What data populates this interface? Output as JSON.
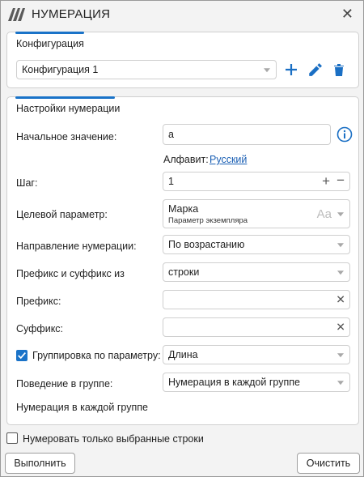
{
  "window": {
    "title": "НУМЕРАЦИЯ"
  },
  "configuration": {
    "group_title": "Конфигурация",
    "selected": "Конфигурация 1"
  },
  "settings": {
    "group_title": "Настройки нумерации",
    "start_value": {
      "label": "Начальное значение:",
      "value": "а"
    },
    "alphabet": {
      "label": "Алфавит:",
      "value": "Русский"
    },
    "step": {
      "label": "Шаг:",
      "value": "1"
    },
    "target_param": {
      "label": "Целевой параметр:",
      "value": "Марка",
      "subtitle": "Параметр экземпляра",
      "case_icon_text": "Aa"
    },
    "direction": {
      "label": "Направление нумерации:",
      "value": "По возрастанию"
    },
    "prefix_suffix_source": {
      "label": "Префикс и суффикс из",
      "value": "строки"
    },
    "prefix": {
      "label": "Префикс:",
      "value": ""
    },
    "suffix": {
      "label": "Суффикс:",
      "value": ""
    },
    "grouping": {
      "label": "Группировка по параметру:",
      "checked": true,
      "value": "Длина"
    },
    "group_behavior": {
      "label": "Поведение в группе:",
      "value": "Нумерация в каждой группе"
    },
    "group_behavior_note": "Нумерация в каждой группе"
  },
  "footer": {
    "only_selected_label": "Нумеровать только выбранные строки",
    "only_selected_checked": false,
    "run_label": "Выполнить",
    "clear_label": "Очистить"
  },
  "colors": {
    "accent": "#1a73c8",
    "icon_blue": "#1a6fc4"
  }
}
